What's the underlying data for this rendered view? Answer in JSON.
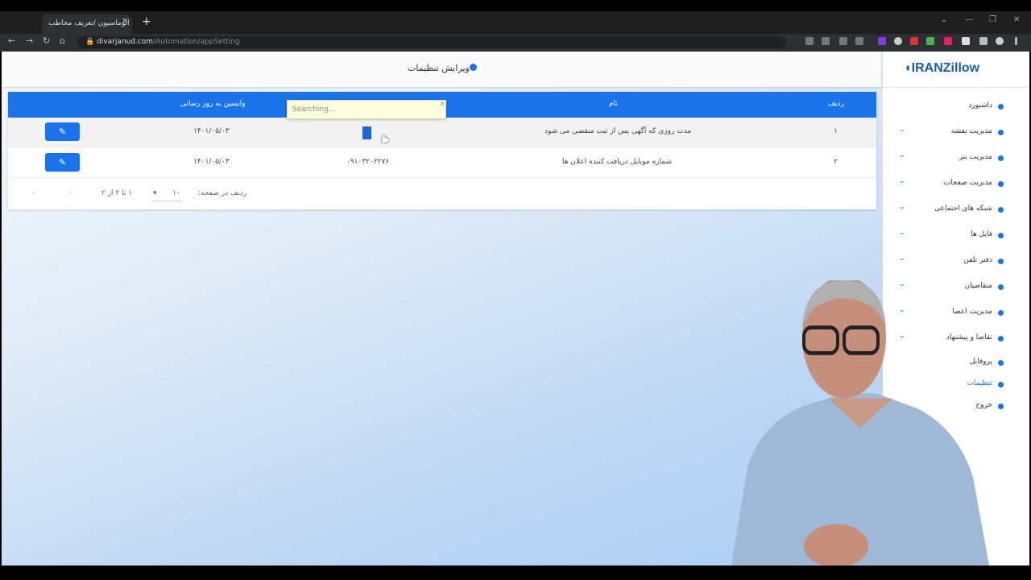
{
  "browser": {
    "tab_title": "اتوماسیون /تعریف مخاطب",
    "tab_close": "✕",
    "new_tab": "+",
    "url_host": "divarjanud.com",
    "url_path": "/Automation/appSetting",
    "window_controls": [
      "⌄",
      "—",
      "❐",
      "✕"
    ],
    "nav_icons": [
      "arrow-left-icon",
      "arrow-right-icon",
      "reload-icon",
      "home-icon"
    ]
  },
  "header": {
    "title": "ویرایش تنظیمات"
  },
  "sidebar": {
    "logo": "IRANZillow",
    "items": [
      {
        "label": "داشبورد",
        "has_chevron": false
      },
      {
        "label": "مدیریت نقشه",
        "has_chevron": true
      },
      {
        "label": "مدیریت بنر",
        "has_chevron": true
      },
      {
        "label": "مدیریت صفحات",
        "has_chevron": true
      },
      {
        "label": "شبکه های اجتماعی",
        "has_chevron": true
      },
      {
        "label": "فایل ها",
        "has_chevron": true
      },
      {
        "label": "دفتر تلفن",
        "has_chevron": true
      },
      {
        "label": "متقاضیان",
        "has_chevron": true
      },
      {
        "label": "مدیریت اعضا",
        "has_chevron": true
      },
      {
        "label": "تقاضا و پیشنهاد",
        "has_chevron": true
      },
      {
        "label": "پروفایل",
        "has_chevron": false
      },
      {
        "label": "تنظیمات",
        "has_chevron": false,
        "active": true
      },
      {
        "label": "خروج",
        "has_chevron": false
      }
    ]
  },
  "table": {
    "columns": [
      "ردیف",
      "نام",
      "",
      "وایسین به روز رسانی",
      ""
    ],
    "rows": [
      {
        "index": "۱",
        "name": "مدت روزی که آگهی پس از ثبت منقضی می شود",
        "value": "۳",
        "updated": "۱۴۰۱/۰۵/۰۳"
      },
      {
        "index": "۲",
        "name": "شماره موبایل دریافت کننده اعلان ها",
        "value": "۰۹۱۰۳۲۰۲۲۷۶",
        "updated": "۱۴۰۱/۰۵/۰۳"
      }
    ],
    "edit_icon": "edit-icon"
  },
  "pagination": {
    "rows_per_page_label": "ردیف در صفحه:",
    "rows_per_page_value": "۱۰",
    "range_text": "۱ تا ۲ از ۲",
    "prev_icon": "chevron-left-icon",
    "next_icon": "chevron-right-icon"
  },
  "tooltip": {
    "text": "Searching...",
    "close": "×"
  },
  "colors": {
    "accent": "#1a73e8",
    "logo": "#1e5ba8"
  }
}
